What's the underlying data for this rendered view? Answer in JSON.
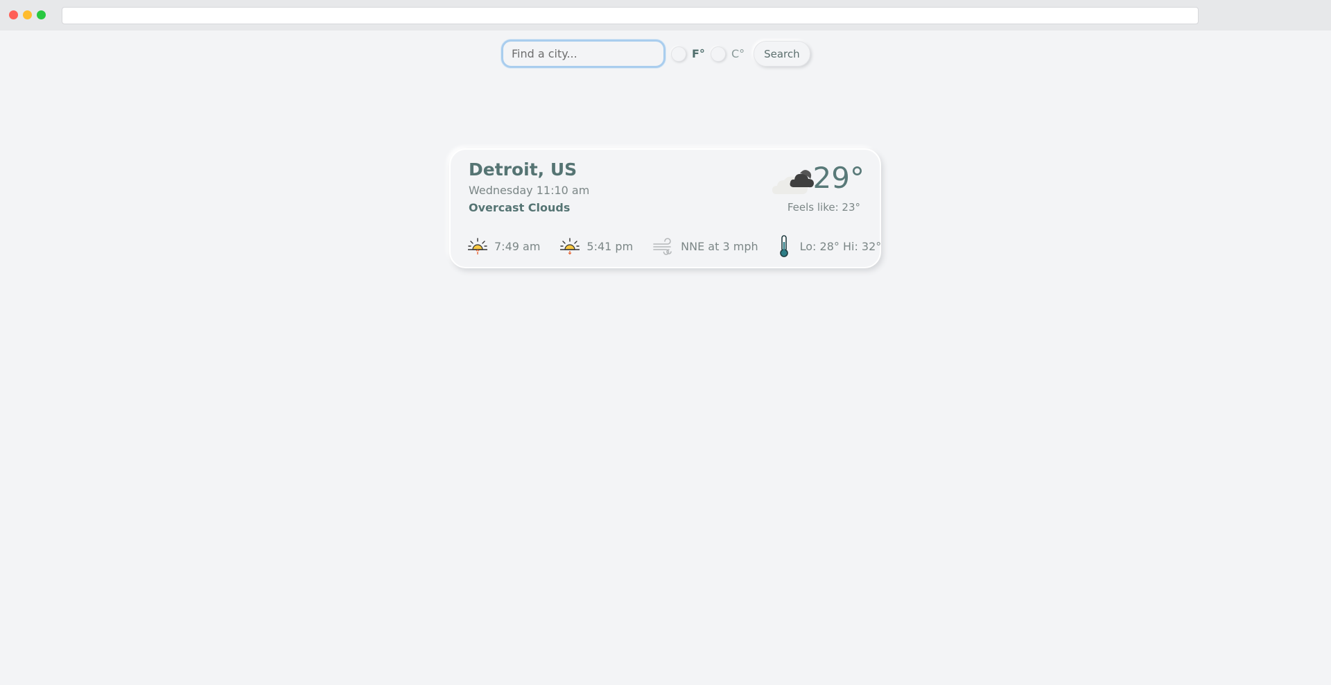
{
  "search": {
    "placeholder": "Find a city...",
    "unit_f_label": "F°",
    "unit_c_label": "C°",
    "button_label": "Search",
    "selected_unit": "F"
  },
  "weather": {
    "city": "Detroit, US",
    "datetime": "Wednesday 11:10 am",
    "description": "Overcast Clouds",
    "icon": "overcast-clouds-icon",
    "temperature": "29°",
    "feels_like": "Feels like: 23°",
    "sunrise": "7:49 am",
    "sunset": "5:41 pm",
    "wind": "NNE at 3 mph",
    "lo_hi": "Lo: 28° Hi: 32°"
  },
  "colors": {
    "background": "#f3f4f6",
    "accent_text": "#557473",
    "muted_text": "#7b8686",
    "input_focus_border": "#a9cdee",
    "sun": "#f7c843",
    "thermometer": "#2d7d86"
  }
}
